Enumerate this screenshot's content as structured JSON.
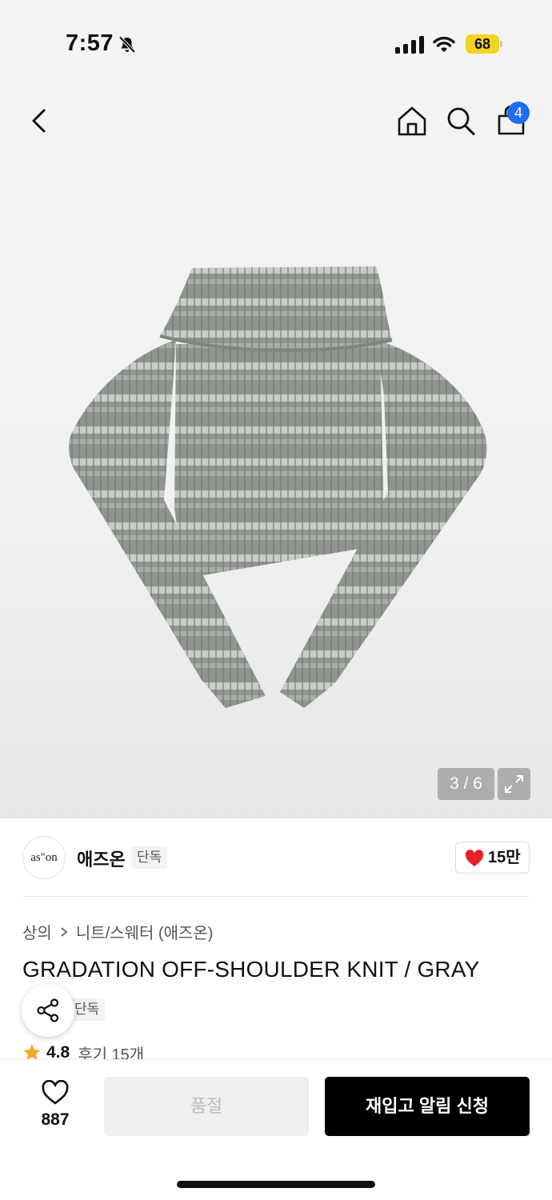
{
  "status_bar": {
    "time": "7:57",
    "battery": "68",
    "icons": [
      "bell-slash-icon",
      "signal-icon",
      "wifi-icon",
      "battery-icon"
    ],
    "battery_color": "#f6d321"
  },
  "nav": {
    "icons": [
      "back-arrow-icon",
      "home-icon",
      "search-icon",
      "shopping-bag-icon"
    ],
    "cart_count": "4",
    "badge_color": "#1f6cf5"
  },
  "gallery": {
    "counter": "3 / 6",
    "icons": [
      "product-image",
      "expand-icon"
    ]
  },
  "brand": {
    "logo_text": "as\"on",
    "name": "애즈온",
    "tag": "단독"
  },
  "likes": {
    "count": "15만",
    "icon": "heart-filled-icon",
    "color": "#e8202a"
  },
  "product": {
    "breadcrumb": [
      "상의",
      "니트/스웨터 (애즈온)"
    ],
    "title": "GRADATION OFF-SHOULDER KNIT / GRAY",
    "exclusive_tag": "단독",
    "rating": "4.8",
    "reviews": "후기 15개"
  },
  "bottom_bar": {
    "wish_count": "887",
    "soldout_label": "품절",
    "restock_label": "재입고 알림 신청",
    "icons": [
      "heart-outline-icon",
      "share-icon",
      "star-icon"
    ]
  }
}
